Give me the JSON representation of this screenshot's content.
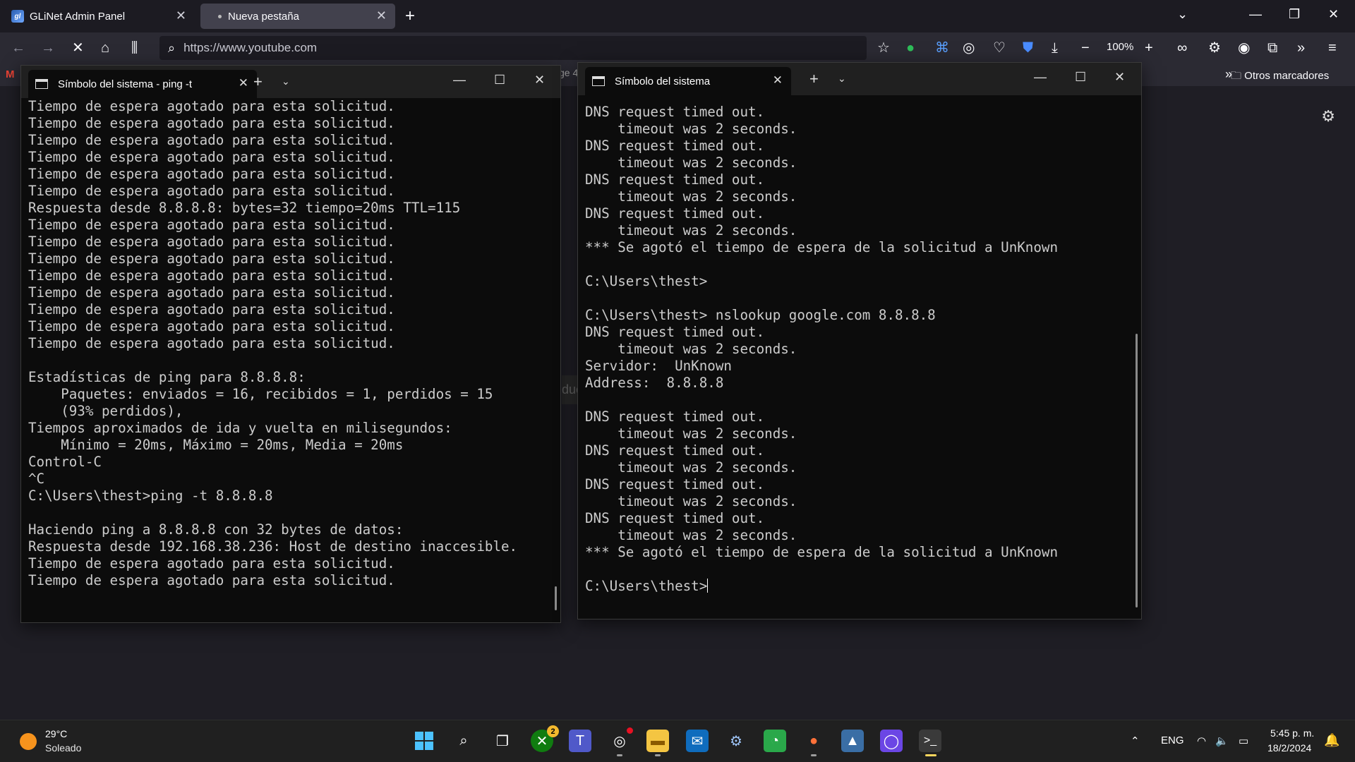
{
  "browser": {
    "tabs": [
      {
        "favicon": "gl",
        "label": "GLiNet Admin Panel"
      },
      {
        "label": "Nueva pestaña"
      }
    ],
    "url": "https://www.youtube.com",
    "zoom": "100%",
    "bookmark_other": "Otros marcadores",
    "gmail_letter": "M"
  },
  "behind": {
    "fragment_top": "ge 4",
    "fragment_mid": "duc"
  },
  "left_terminal": {
    "tab_title": "Símbolo del sistema - ping -t",
    "lines": [
      "Tiempo de espera agotado para esta solicitud.",
      "Tiempo de espera agotado para esta solicitud.",
      "Tiempo de espera agotado para esta solicitud.",
      "Tiempo de espera agotado para esta solicitud.",
      "Tiempo de espera agotado para esta solicitud.",
      "Tiempo de espera agotado para esta solicitud.",
      "Respuesta desde 8.8.8.8: bytes=32 tiempo=20ms TTL=115",
      "Tiempo de espera agotado para esta solicitud.",
      "Tiempo de espera agotado para esta solicitud.",
      "Tiempo de espera agotado para esta solicitud.",
      "Tiempo de espera agotado para esta solicitud.",
      "Tiempo de espera agotado para esta solicitud.",
      "Tiempo de espera agotado para esta solicitud.",
      "Tiempo de espera agotado para esta solicitud.",
      "Tiempo de espera agotado para esta solicitud.",
      "",
      "Estadísticas de ping para 8.8.8.8:",
      "    Paquetes: enviados = 16, recibidos = 1, perdidos = 15",
      "    (93% perdidos),",
      "Tiempos aproximados de ida y vuelta en milisegundos:",
      "    Mínimo = 20ms, Máximo = 20ms, Media = 20ms",
      "Control-C",
      "^C",
      "C:\\Users\\thest>ping -t 8.8.8.8",
      "",
      "Haciendo ping a 8.8.8.8 con 32 bytes de datos:",
      "Respuesta desde 192.168.38.236: Host de destino inaccesible.",
      "Tiempo de espera agotado para esta solicitud.",
      "Tiempo de espera agotado para esta solicitud."
    ]
  },
  "right_terminal": {
    "tab_title": "Símbolo del sistema",
    "lines": [
      "DNS request timed out.",
      "    timeout was 2 seconds.",
      "DNS request timed out.",
      "    timeout was 2 seconds.",
      "DNS request timed out.",
      "    timeout was 2 seconds.",
      "DNS request timed out.",
      "    timeout was 2 seconds.",
      "*** Se agotó el tiempo de espera de la solicitud a UnKnown",
      "",
      "C:\\Users\\thest>",
      "",
      "C:\\Users\\thest> nslookup google.com 8.8.8.8",
      "DNS request timed out.",
      "    timeout was 2 seconds.",
      "Servidor:  UnKnown",
      "Address:  8.8.8.8",
      "",
      "DNS request timed out.",
      "    timeout was 2 seconds.",
      "DNS request timed out.",
      "    timeout was 2 seconds.",
      "DNS request timed out.",
      "    timeout was 2 seconds.",
      "DNS request timed out.",
      "    timeout was 2 seconds.",
      "*** Se agotó el tiempo de espera de la solicitud a UnKnown",
      ""
    ],
    "prompt": "C:\\Users\\thest>"
  },
  "taskbar": {
    "weather_temp": "29°C",
    "weather_desc": "Soleado",
    "xbox_badge": "2",
    "language": "ENG",
    "time": "5:45 p. m.",
    "date": "18/2/2024"
  },
  "colors": {
    "terminal_bg": "#0c0c0c",
    "terminal_text": "#cccccc",
    "browser_chrome": "#2b2a33",
    "taskbar": "#202020",
    "active_indicator": "#ffd75e"
  }
}
